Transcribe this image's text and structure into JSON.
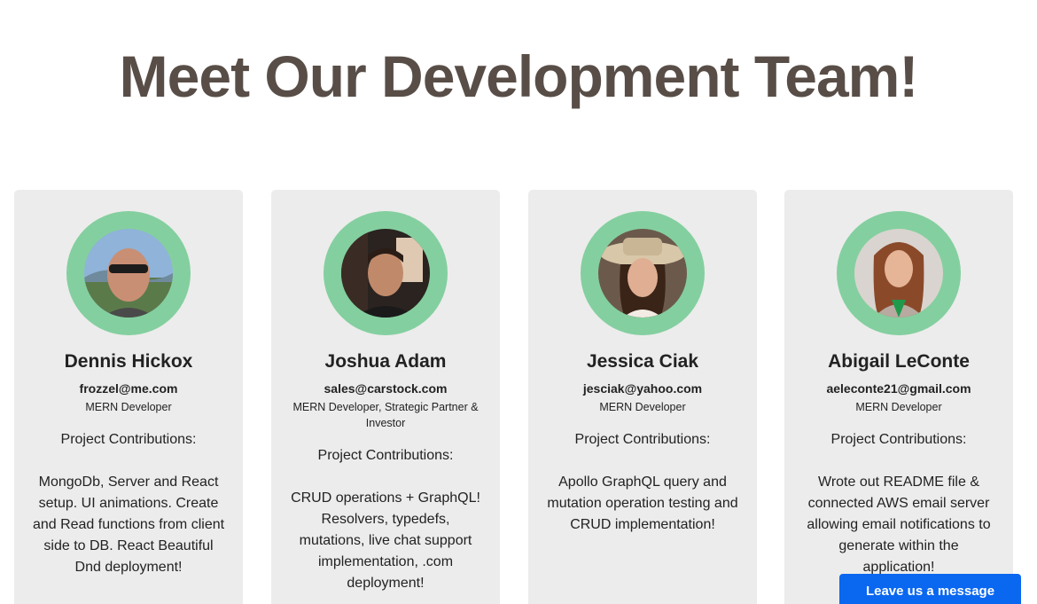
{
  "page": {
    "title": "Meet Our Development Team!"
  },
  "team": [
    {
      "name": "Dennis Hickox",
      "email": "frozzel@me.com",
      "role": "MERN Developer",
      "contrib_title": "Project Contributions:",
      "contrib_text": "MongoDb, Server and React setup. UI animations. Create and Read functions from client side to DB. React Beautiful Dnd deployment!"
    },
    {
      "name": "Joshua Adam",
      "email": "sales@carstock.com",
      "role": "MERN Developer, Strategic Partner & Investor",
      "contrib_title": "Project Contributions:",
      "contrib_text": "CRUD operations + GraphQL! Resolvers, typedefs, mutations, live chat support implementation, .com deployment!"
    },
    {
      "name": "Jessica Ciak",
      "email": "jesciak@yahoo.com",
      "role": "MERN Developer",
      "contrib_title": "Project Contributions:",
      "contrib_text": "Apollo GraphQL query and mutation operation testing and CRUD implementation!"
    },
    {
      "name": "Abigail LeConte",
      "email": "aeleconte21@gmail.com",
      "role": "MERN Developer",
      "contrib_title": "Project Contributions:",
      "contrib_text": "Wrote out README file & connected AWS email server allowing email notifications to generate within the application!"
    }
  ],
  "chat": {
    "label": "Leave us a message"
  },
  "colors": {
    "title": "#584e47",
    "card_bg": "#ececec",
    "avatar_ring": "#84cf9f",
    "chat_button": "#0a67f0"
  }
}
